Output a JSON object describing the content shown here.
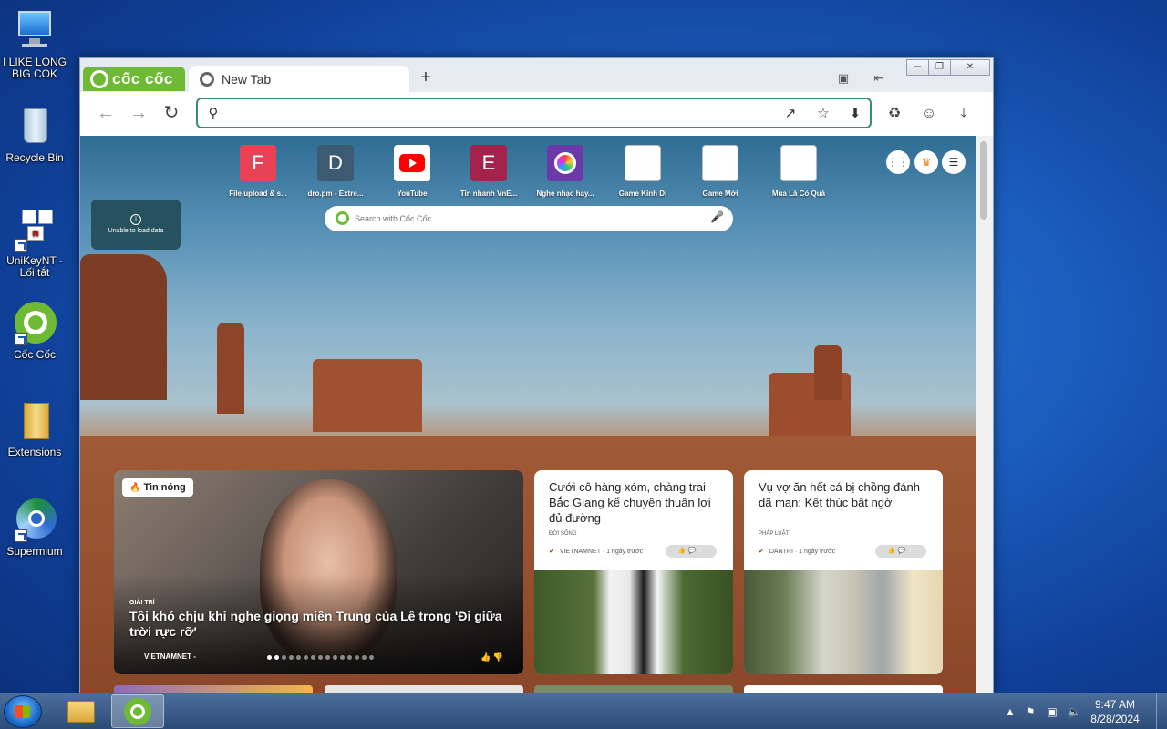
{
  "desktop": {
    "icons": [
      {
        "label": "I LIKE LONG BIG COK",
        "icon": "computer-icon"
      },
      {
        "label": "Recycle Bin",
        "icon": "recycle-bin-icon"
      },
      {
        "label": "UniKeyNT - Lối tắt",
        "icon": "unikey-icon"
      },
      {
        "label": "Cốc Cốc",
        "icon": "coccoc-icon"
      },
      {
        "label": "Extensions",
        "icon": "folder-icon"
      },
      {
        "label": "Supermium",
        "icon": "supermium-icon"
      }
    ]
  },
  "browser": {
    "logo": "cốc cốc",
    "tab_title": "New Tab",
    "new_tab": "+",
    "address_value": "",
    "colors": {
      "brand": "#6fba34",
      "omnibox_border": "#3a8d74"
    }
  },
  "newtab": {
    "speed_dial": [
      {
        "letter": "F",
        "label": "File upload & s...",
        "color": "#e94156"
      },
      {
        "letter": "D",
        "label": "dro.pm - Extre...",
        "color": "#3d5a73"
      },
      {
        "letter": "",
        "label": "YouTube",
        "color": "#ffffff"
      },
      {
        "letter": "E",
        "label": "Tin nhanh VnE...",
        "color": "#a3234c"
      },
      {
        "letter": "",
        "label": "Nghe nhạc hay...",
        "color": "#6b3aa8"
      },
      {
        "letter": "",
        "label": "Game Kinh Dị",
        "color": "#ffffff"
      },
      {
        "letter": "",
        "label": "Game Mới",
        "color": "#ffffff"
      },
      {
        "letter": "",
        "label": "Mua Là Có Quà",
        "color": "#ffffff"
      }
    ],
    "weather": "Unable to load data",
    "search_placeholder": "Search with Cốc Cốc",
    "news_main": {
      "badge": "Tin nóng",
      "category": "GIẢI TRÍ",
      "title": "Tôi khó chịu khi nghe giọng miền Trung của Lê trong 'Đi giữa trời rực rỡ'",
      "source": "VIETNAMNET -"
    },
    "news_cards": [
      {
        "title": "Cưới cô hàng xóm, chàng trai Bắc Giang kể chuyện thuận lợi đủ đường",
        "category": "ĐỜI SỐNG",
        "source": "VIETNAMNET · 1 ngày trước"
      },
      {
        "title": "Vụ vợ ăn hết cá bị chồng đánh dã man: Kết thúc bất ngờ",
        "category": "PHÁP LUẬT",
        "source": "DANTRI · 1 ngày trước"
      }
    ]
  },
  "taskbar": {
    "time": "9:47 AM",
    "date": "8/28/2024"
  }
}
